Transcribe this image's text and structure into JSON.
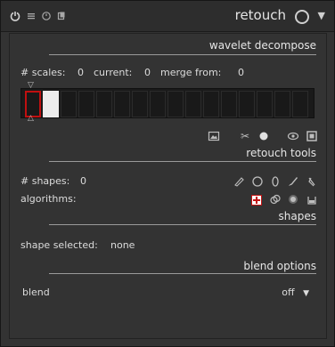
{
  "header": {
    "title": "retouch",
    "icons": [
      "power-icon",
      "hamburger-icon",
      "reset-icon",
      "presets-menu-icon"
    ]
  },
  "wavelet": {
    "section_title": "wavelet decompose",
    "scales_label": "# scales:",
    "scales_value": "0",
    "current_label": "current:",
    "current_value": "0",
    "merge_label": "merge from:",
    "merge_value": "0"
  },
  "retouch_tools": {
    "section_title": "retouch tools",
    "shapes_label": "# shapes:",
    "shapes_value": "0",
    "algorithms_label": "algorithms:"
  },
  "shapes": {
    "section_title": "shapes",
    "selected_label": "shape selected:",
    "selected_value": "none"
  },
  "blend": {
    "section_title": "blend options",
    "label": "blend",
    "value": "off"
  },
  "colors": {
    "accent_red": "#c41313",
    "panel_bg": "#333333"
  }
}
